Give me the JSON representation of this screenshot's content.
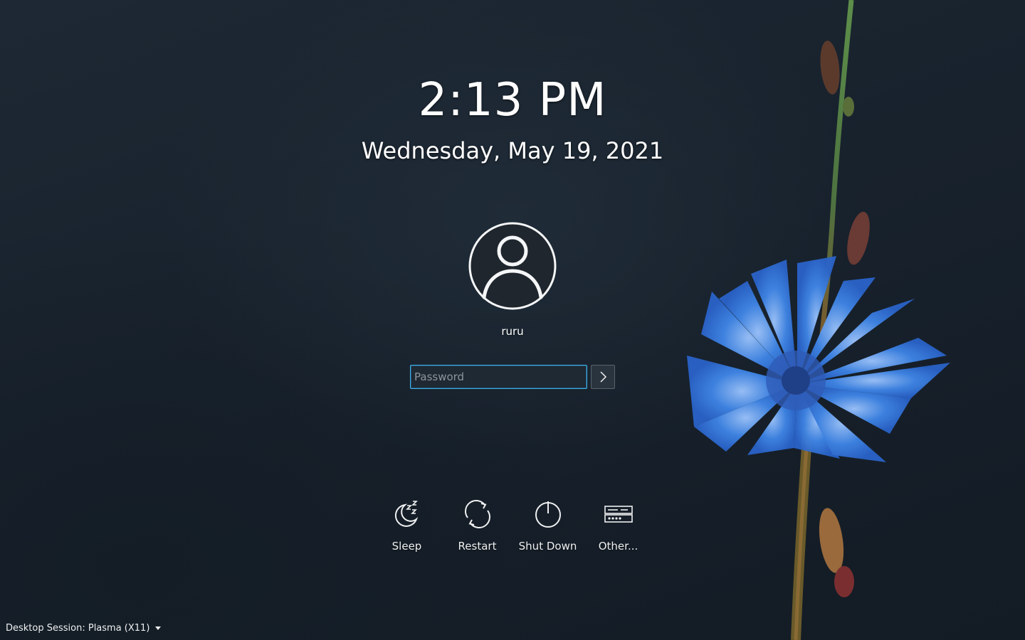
{
  "clock": {
    "time": "2:13 PM",
    "date": "Wednesday, May 19, 2021"
  },
  "user": {
    "name": "ruru",
    "avatar_icon": "user-avatar-icon"
  },
  "login": {
    "password_placeholder": "Password",
    "submit_icon": "chevron-right-icon"
  },
  "actions": [
    {
      "label": "Sleep",
      "icon": "sleep-icon"
    },
    {
      "label": "Restart",
      "icon": "restart-icon"
    },
    {
      "label": "Shut Down",
      "icon": "power-icon"
    },
    {
      "label": "Other...",
      "icon": "other-users-icon"
    }
  ],
  "session": {
    "label": "Desktop Session: Plasma (X11)"
  },
  "colors": {
    "accent": "#3daee9",
    "background": "#18222d",
    "text": "#eff0f1",
    "flower": "#3f86e8"
  }
}
